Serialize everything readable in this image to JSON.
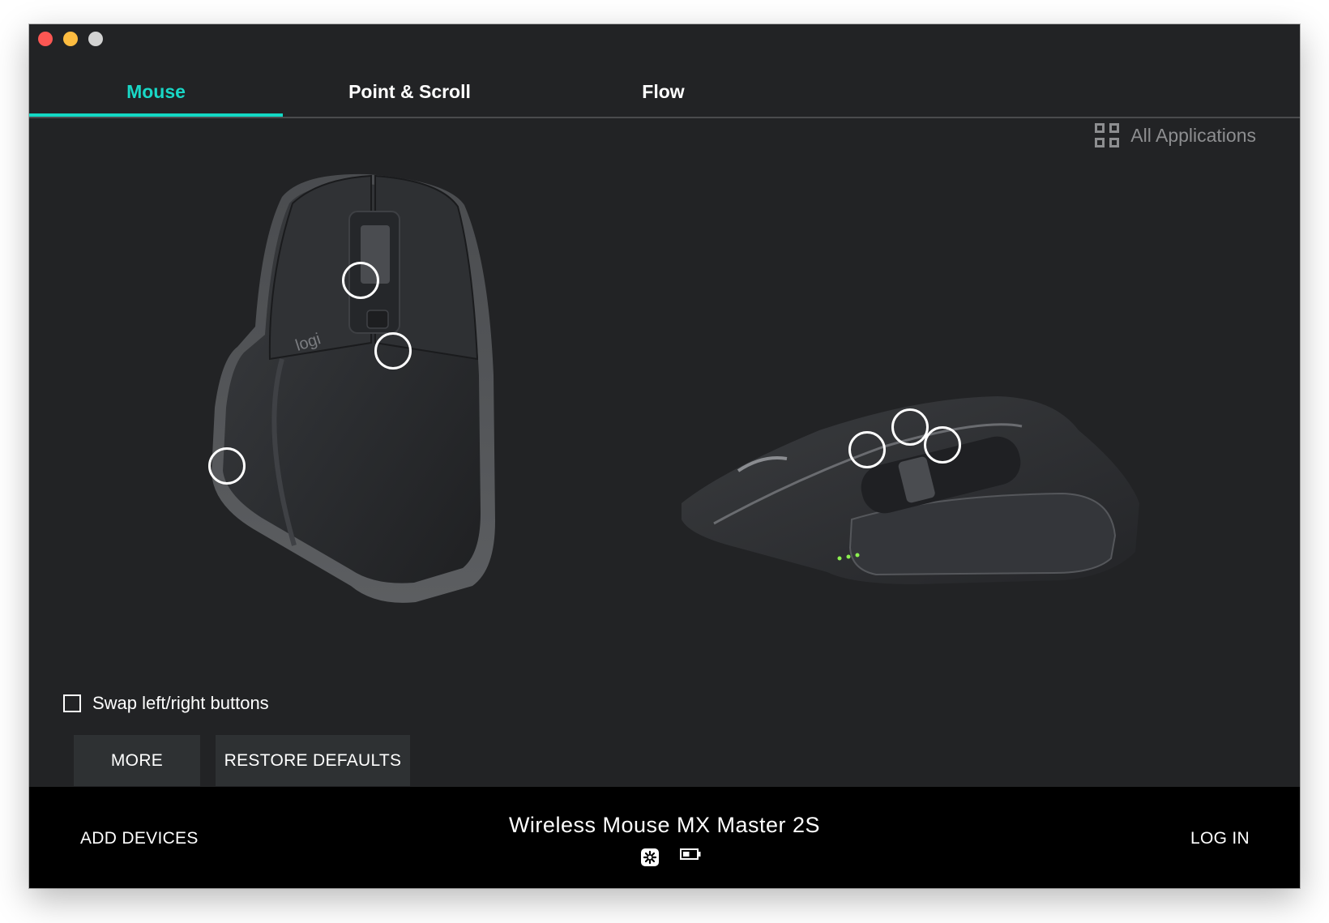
{
  "window": {
    "controls": [
      "close",
      "minimize",
      "maximize"
    ]
  },
  "tabs": [
    {
      "label": "Mouse",
      "active": true
    },
    {
      "label": "Point & Scroll",
      "active": false
    },
    {
      "label": "Flow",
      "active": false
    }
  ],
  "app_selector": {
    "label": "All Applications",
    "icon": "grid-icon"
  },
  "colors": {
    "accent": "#13d8c4",
    "background": "#222325",
    "button_bg": "#2e3133",
    "footer_bg": "#000000",
    "text": "#ffffff",
    "muted_text": "#8d8e90",
    "led": "#8cf050"
  },
  "device_views": {
    "top_view": {
      "name": "MX Master 2S top view",
      "logo_text": "logi",
      "hotspots": [
        "scroll-wheel",
        "mode-shift-button",
        "gesture-button"
      ]
    },
    "side_view": {
      "name": "MX Master 2S side view",
      "hotspots": [
        "thumb-wheel",
        "forward-button",
        "back-button"
      ],
      "led_count": 3
    }
  },
  "options": {
    "swap_buttons": {
      "label": "Swap left/right buttons",
      "checked": false
    }
  },
  "buttons": {
    "more": "MORE",
    "restore_defaults": "RESTORE DEFAULTS"
  },
  "footer": {
    "add_devices": "ADD DEVICES",
    "device_name": "Wireless Mouse MX Master 2S",
    "connection_icon": "unifying-receiver-icon",
    "battery_icon": "battery-icon",
    "battery_level_fraction": 0.5,
    "log_in": "LOG IN"
  }
}
